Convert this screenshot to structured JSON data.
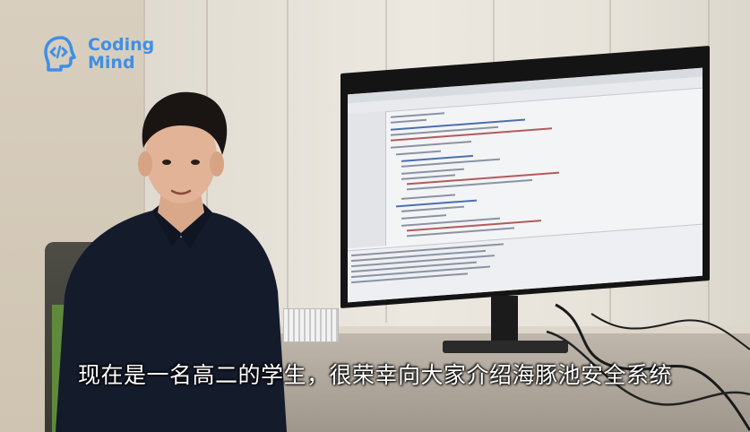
{
  "logo": {
    "line1": "Coding",
    "line2": "Mind",
    "icon": "brain-code-icon",
    "color": "#3f8fe6"
  },
  "subtitle": {
    "text": "现在是一名高二的学生，很荣幸向大家介绍海豚池安全系统"
  },
  "scene": {
    "monitor_screen": "code-editor",
    "shirt_color": "#141b2b"
  }
}
